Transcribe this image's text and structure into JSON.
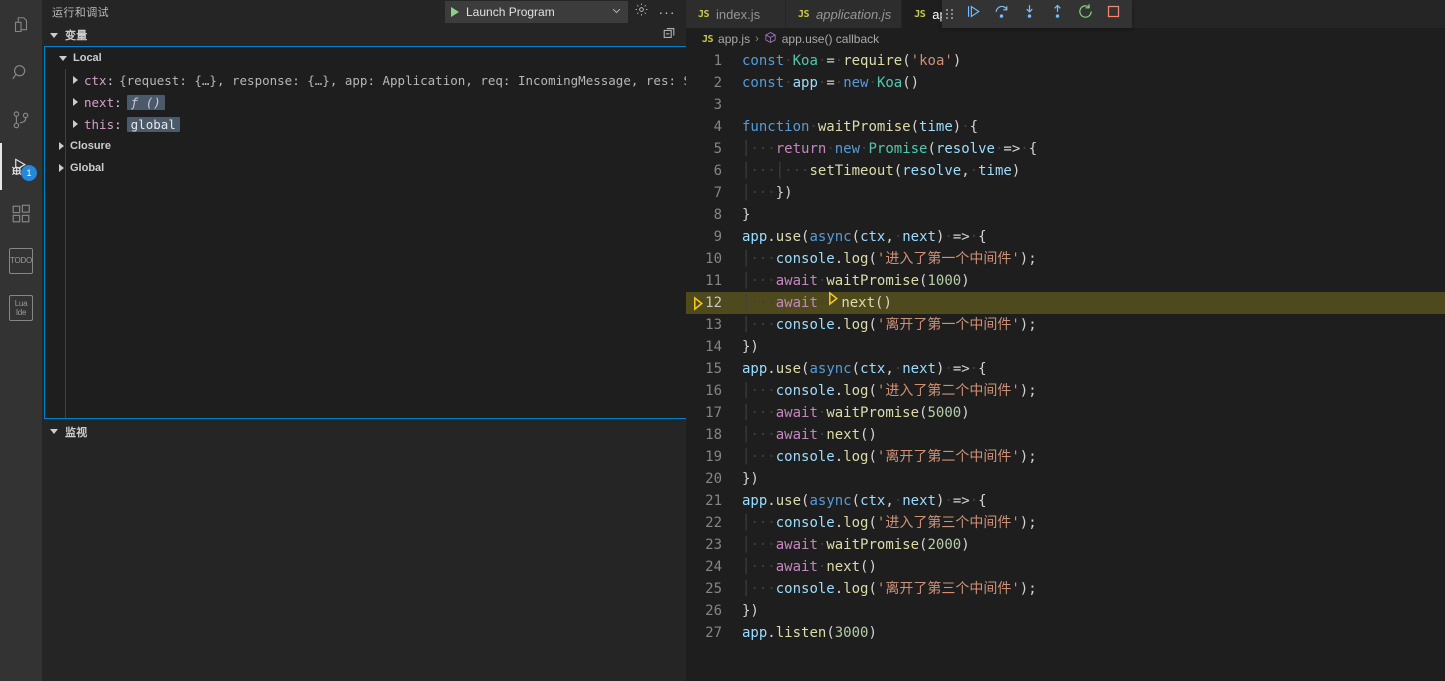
{
  "activitybar": {
    "items": [
      {
        "name": "explorer",
        "icon": "files-icon"
      },
      {
        "name": "search",
        "icon": "search-icon"
      },
      {
        "name": "source-control",
        "icon": "source-control-icon"
      },
      {
        "name": "run-and-debug",
        "icon": "run-debug-icon",
        "badge": "1",
        "active": true
      },
      {
        "name": "extensions",
        "icon": "extensions-icon"
      },
      {
        "name": "todo",
        "icon": "todo-icon",
        "label": "TODO"
      },
      {
        "name": "lua-ide",
        "icon": "lua-ide-icon",
        "label_line1": "Lua",
        "label_line2": "Ide"
      }
    ]
  },
  "sidebar": {
    "title": "运行和调试",
    "launch": {
      "config_label": "Launch Program",
      "play_icon": "play-icon",
      "dropdown_icon": "chevron-down-icon",
      "settings_icon": "gear-icon",
      "more_icon": "ellipsis-icon"
    },
    "variables": {
      "section_title": "变量",
      "collapse_icon": "collapse-all-icon",
      "scopes": [
        {
          "name": "Local",
          "expanded": true,
          "children": [
            {
              "name": "ctx",
              "separator": ":",
              "value": "{request: {…}, response: {…}, app: Application, req: IncomingMessage, res: Serv…",
              "chip": false
            },
            {
              "name": "next",
              "separator": ":",
              "value": "ƒ ()",
              "chip": true,
              "italic": true
            },
            {
              "name": "this",
              "separator": ":",
              "value": "global",
              "chip": true,
              "italic": false
            }
          ]
        },
        {
          "name": "Closure",
          "expanded": false,
          "children": []
        },
        {
          "name": "Global",
          "expanded": false,
          "children": []
        }
      ]
    },
    "watch": {
      "section_title": "监视"
    }
  },
  "editor": {
    "tabs": [
      {
        "label": "index.js",
        "icon": "js-icon",
        "active": false,
        "italic": false,
        "closable": false
      },
      {
        "label": "application.js",
        "icon": "js-icon",
        "active": false,
        "italic": true,
        "closable": false
      },
      {
        "label": "app.js",
        "icon": "js-icon",
        "active": true,
        "italic": false,
        "closable": true,
        "close_icon": "close-icon"
      }
    ],
    "breadcrumb": {
      "file_icon": "js-icon",
      "file": "app.js",
      "separator": "›",
      "symbol_icon": "symbol-function-icon",
      "symbol": "app.use() callback"
    },
    "debug_toolbar": {
      "grip_icon": "drag-handle-icon",
      "buttons": [
        {
          "name": "continue-button",
          "icon": "continue-icon",
          "color": "#75beff"
        },
        {
          "name": "step-over-button",
          "icon": "step-over-icon",
          "color": "#75beff"
        },
        {
          "name": "step-into-button",
          "icon": "step-into-icon",
          "color": "#75beff"
        },
        {
          "name": "step-out-button",
          "icon": "step-out-icon",
          "color": "#75beff"
        },
        {
          "name": "restart-button",
          "icon": "restart-icon",
          "color": "#89d185"
        },
        {
          "name": "stop-button",
          "icon": "stop-icon",
          "color": "#f48771"
        }
      ]
    },
    "current_line": 12,
    "debug_marker_icon": "debug-stackframe-icon",
    "lines": [
      {
        "n": "1",
        "tokens": [
          {
            "t": "const",
            "c": "kw"
          },
          {
            "t": " ",
            "c": "ws"
          },
          {
            "t": "Koa",
            "c": "cls"
          },
          {
            "t": " = ",
            "c": "op"
          },
          {
            "t": "require",
            "c": "fn"
          },
          {
            "t": "(",
            "c": "pun"
          },
          {
            "t": "'koa'",
            "c": "str"
          },
          {
            "t": ")",
            "c": "pun"
          }
        ]
      },
      {
        "n": "2",
        "tokens": [
          {
            "t": "const",
            "c": "kw"
          },
          {
            "t": " ",
            "c": "ws"
          },
          {
            "t": "app",
            "c": "var"
          },
          {
            "t": " = ",
            "c": "op"
          },
          {
            "t": "new",
            "c": "kw"
          },
          {
            "t": " ",
            "c": "ws"
          },
          {
            "t": "Koa",
            "c": "cls"
          },
          {
            "t": "()",
            "c": "pun"
          }
        ]
      },
      {
        "n": "3",
        "tokens": []
      },
      {
        "n": "4",
        "tokens": [
          {
            "t": "function",
            "c": "kw"
          },
          {
            "t": " ",
            "c": "ws"
          },
          {
            "t": "waitPromise",
            "c": "fn"
          },
          {
            "t": "(",
            "c": "pun"
          },
          {
            "t": "time",
            "c": "var"
          },
          {
            "t": ") {",
            "c": "pun"
          }
        ]
      },
      {
        "n": "5",
        "indent": 1,
        "tokens": [
          {
            "t": "return",
            "c": "kwp"
          },
          {
            "t": " ",
            "c": "ws"
          },
          {
            "t": "new",
            "c": "kw"
          },
          {
            "t": " ",
            "c": "ws"
          },
          {
            "t": "Promise",
            "c": "cls"
          },
          {
            "t": "(",
            "c": "pun"
          },
          {
            "t": "resolve",
            "c": "var"
          },
          {
            "t": " => {",
            "c": "op"
          }
        ]
      },
      {
        "n": "6",
        "indent": 2,
        "tokens": [
          {
            "t": "setTimeout",
            "c": "fn"
          },
          {
            "t": "(",
            "c": "pun"
          },
          {
            "t": "resolve",
            "c": "var"
          },
          {
            "t": ", ",
            "c": "pun"
          },
          {
            "t": "time",
            "c": "var"
          },
          {
            "t": ")",
            "c": "pun"
          }
        ]
      },
      {
        "n": "7",
        "indent": 1,
        "tokens": [
          {
            "t": "})",
            "c": "pun"
          }
        ]
      },
      {
        "n": "8",
        "tokens": [
          {
            "t": "}",
            "c": "pun"
          }
        ]
      },
      {
        "n": "9",
        "tokens": [
          {
            "t": "app",
            "c": "var"
          },
          {
            "t": ".",
            "c": "pun"
          },
          {
            "t": "use",
            "c": "fn"
          },
          {
            "t": "(",
            "c": "pun"
          },
          {
            "t": "async",
            "c": "kw"
          },
          {
            "t": "(",
            "c": "pun"
          },
          {
            "t": "ctx",
            "c": "var"
          },
          {
            "t": ", ",
            "c": "pun"
          },
          {
            "t": "next",
            "c": "var"
          },
          {
            "t": ") => {",
            "c": "op"
          }
        ]
      },
      {
        "n": "10",
        "indent": 1,
        "tokens": [
          {
            "t": "console",
            "c": "var"
          },
          {
            "t": ".",
            "c": "pun"
          },
          {
            "t": "log",
            "c": "fn"
          },
          {
            "t": "(",
            "c": "pun"
          },
          {
            "t": "'进入了第一个中间件'",
            "c": "str"
          },
          {
            "t": ");",
            "c": "pun"
          }
        ]
      },
      {
        "n": "11",
        "indent": 1,
        "tokens": [
          {
            "t": "await",
            "c": "kwp"
          },
          {
            "t": " ",
            "c": "ws"
          },
          {
            "t": "waitPromise",
            "c": "fn"
          },
          {
            "t": "(",
            "c": "pun"
          },
          {
            "t": "1000",
            "c": "num"
          },
          {
            "t": ")",
            "c": "pun"
          }
        ]
      },
      {
        "n": "12",
        "indent": 1,
        "highlight": true,
        "inline_marker": true,
        "tokens": [
          {
            "t": "await",
            "c": "kwp"
          },
          {
            "t": " ",
            "c": "ws"
          },
          {
            "t": "next",
            "c": "fn"
          },
          {
            "t": "()",
            "c": "pun"
          }
        ]
      },
      {
        "n": "13",
        "indent": 1,
        "tokens": [
          {
            "t": "console",
            "c": "var"
          },
          {
            "t": ".",
            "c": "pun"
          },
          {
            "t": "log",
            "c": "fn"
          },
          {
            "t": "(",
            "c": "pun"
          },
          {
            "t": "'离开了第一个中间件'",
            "c": "str"
          },
          {
            "t": ");",
            "c": "pun"
          }
        ]
      },
      {
        "n": "14",
        "tokens": [
          {
            "t": "})",
            "c": "pun"
          }
        ]
      },
      {
        "n": "15",
        "tokens": [
          {
            "t": "app",
            "c": "var"
          },
          {
            "t": ".",
            "c": "pun"
          },
          {
            "t": "use",
            "c": "fn"
          },
          {
            "t": "(",
            "c": "pun"
          },
          {
            "t": "async",
            "c": "kw"
          },
          {
            "t": "(",
            "c": "pun"
          },
          {
            "t": "ctx",
            "c": "var"
          },
          {
            "t": ", ",
            "c": "pun"
          },
          {
            "t": "next",
            "c": "var"
          },
          {
            "t": ") => {",
            "c": "op"
          }
        ]
      },
      {
        "n": "16",
        "indent": 1,
        "tokens": [
          {
            "t": "console",
            "c": "var"
          },
          {
            "t": ".",
            "c": "pun"
          },
          {
            "t": "log",
            "c": "fn"
          },
          {
            "t": "(",
            "c": "pun"
          },
          {
            "t": "'进入了第二个中间件'",
            "c": "str"
          },
          {
            "t": ");",
            "c": "pun"
          }
        ]
      },
      {
        "n": "17",
        "indent": 1,
        "tokens": [
          {
            "t": "await",
            "c": "kwp"
          },
          {
            "t": " ",
            "c": "ws"
          },
          {
            "t": "waitPromise",
            "c": "fn"
          },
          {
            "t": "(",
            "c": "pun"
          },
          {
            "t": "5000",
            "c": "num"
          },
          {
            "t": ")",
            "c": "pun"
          }
        ]
      },
      {
        "n": "18",
        "indent": 1,
        "tokens": [
          {
            "t": "await",
            "c": "kwp"
          },
          {
            "t": " ",
            "c": "ws"
          },
          {
            "t": "next",
            "c": "fn"
          },
          {
            "t": "()",
            "c": "pun"
          }
        ]
      },
      {
        "n": "19",
        "indent": 1,
        "tokens": [
          {
            "t": "console",
            "c": "var"
          },
          {
            "t": ".",
            "c": "pun"
          },
          {
            "t": "log",
            "c": "fn"
          },
          {
            "t": "(",
            "c": "pun"
          },
          {
            "t": "'离开了第二个中间件'",
            "c": "str"
          },
          {
            "t": ");",
            "c": "pun"
          }
        ]
      },
      {
        "n": "20",
        "tokens": [
          {
            "t": "})",
            "c": "pun"
          }
        ]
      },
      {
        "n": "21",
        "tokens": [
          {
            "t": "app",
            "c": "var"
          },
          {
            "t": ".",
            "c": "pun"
          },
          {
            "t": "use",
            "c": "fn"
          },
          {
            "t": "(",
            "c": "pun"
          },
          {
            "t": "async",
            "c": "kw"
          },
          {
            "t": "(",
            "c": "pun"
          },
          {
            "t": "ctx",
            "c": "var"
          },
          {
            "t": ", ",
            "c": "pun"
          },
          {
            "t": "next",
            "c": "var"
          },
          {
            "t": ") => {",
            "c": "op"
          }
        ]
      },
      {
        "n": "22",
        "indent": 1,
        "tokens": [
          {
            "t": "console",
            "c": "var"
          },
          {
            "t": ".",
            "c": "pun"
          },
          {
            "t": "log",
            "c": "fn"
          },
          {
            "t": "(",
            "c": "pun"
          },
          {
            "t": "'进入了第三个中间件'",
            "c": "str"
          },
          {
            "t": ");",
            "c": "pun"
          }
        ]
      },
      {
        "n": "23",
        "indent": 1,
        "tokens": [
          {
            "t": "await",
            "c": "kwp"
          },
          {
            "t": " ",
            "c": "ws"
          },
          {
            "t": "waitPromise",
            "c": "fn"
          },
          {
            "t": "(",
            "c": "pun"
          },
          {
            "t": "2000",
            "c": "num"
          },
          {
            "t": ")",
            "c": "pun"
          }
        ]
      },
      {
        "n": "24",
        "indent": 1,
        "tokens": [
          {
            "t": "await",
            "c": "kwp"
          },
          {
            "t": " ",
            "c": "ws"
          },
          {
            "t": "next",
            "c": "fn"
          },
          {
            "t": "()",
            "c": "pun"
          }
        ]
      },
      {
        "n": "25",
        "indent": 1,
        "tokens": [
          {
            "t": "console",
            "c": "var"
          },
          {
            "t": ".",
            "c": "pun"
          },
          {
            "t": "log",
            "c": "fn"
          },
          {
            "t": "(",
            "c": "pun"
          },
          {
            "t": "'离开了第三个中间件'",
            "c": "str"
          },
          {
            "t": ");",
            "c": "pun"
          }
        ]
      },
      {
        "n": "26",
        "tokens": [
          {
            "t": "})",
            "c": "pun"
          }
        ]
      },
      {
        "n": "27",
        "tokens": [
          {
            "t": "app",
            "c": "var"
          },
          {
            "t": ".",
            "c": "pun"
          },
          {
            "t": "listen",
            "c": "fn"
          },
          {
            "t": "(",
            "c": "pun"
          },
          {
            "t": "3000",
            "c": "num"
          },
          {
            "t": ")",
            "c": "pun"
          }
        ]
      }
    ]
  },
  "colors": {
    "accent": "#007fd4",
    "highlight_line": "#4f4a1e",
    "badge": "#2488db",
    "play_green": "#89d185",
    "stop_red": "#f48771",
    "debug_marker": "#ffcc00"
  }
}
